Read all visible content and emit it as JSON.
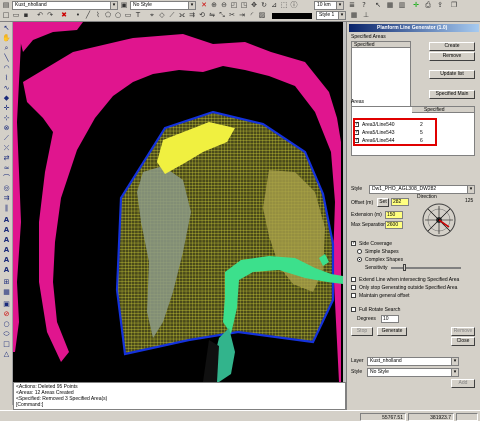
{
  "toolbar": {
    "layer_combo": "Kust_nholland",
    "style_combo": "No Style",
    "scale_combo": "10 km",
    "line_style_combo": "Style 1"
  },
  "colors": {
    "map_background": "#000000",
    "land_magenta": "#e0158e",
    "grid_area": "#c8c833",
    "area_outline": "#1432dc",
    "yellow_blob": "#f0f040",
    "green_channel": "#3ce08c",
    "teal_channel": "#32b48c",
    "grey_shape": "#8c9a86"
  },
  "panel": {
    "title": "Planform Line Generator (1.0)",
    "specified_areas_label": "Specified Areas",
    "specified_header": "Specified",
    "create_btn": "Create",
    "remove_btn": "Remove",
    "update_list_btn": "Update list",
    "specified_main_btn": "Specified Main",
    "areas_label": "Areas",
    "areas_specified_col": "Specified",
    "areas": [
      {
        "name": "Area3/Line540",
        "value": "2"
      },
      {
        "name": "Area5/Line543",
        "value": "5"
      },
      {
        "name": "Area6/Line544",
        "value": "6"
      }
    ],
    "style_label": "Style",
    "style_value": "Dw1_PHO_AGL308_DW282",
    "offset_label": "Offset (m)",
    "set_btn": "Set",
    "offset_value": "282",
    "direction_label": "Direction",
    "direction_value": "125",
    "extension_label": "Extension (m)",
    "extension_value": "150",
    "max_sep_label": "Max Separation",
    "max_sep_value": "2600",
    "side_coverage": "Side Coverage",
    "simple_shapes": "Simple Shapes",
    "complex_shapes": "Complex Shapes",
    "sensitivity": "Sensitivity",
    "opt1": "Extend Line when intersecting Specified Area",
    "opt2": "Only stop Generating outside Specified Area",
    "opt3": "Maintain general offset",
    "full_rotate": "Full Rotate Search",
    "degrees_label": "Degrees",
    "degrees_value": "10",
    "stop_btn": "Stop",
    "generate_btn": "Generate",
    "remove2_btn": "Remove",
    "close_btn": "Close",
    "layer_label": "Layer",
    "layer_value": "Kust_nholland",
    "style2_label": "Style",
    "style2_value": "No Style",
    "add_btn": "Add"
  },
  "command": {
    "lines": [
      "<Actions: Deleted 95 Points",
      "<Areas: 12 Areas Created",
      "<Specified: Removed 3 Specified Area(s)"
    ],
    "prompt": "[Command:]"
  },
  "status": {
    "x": "55767.51",
    "y": "381923.7"
  }
}
